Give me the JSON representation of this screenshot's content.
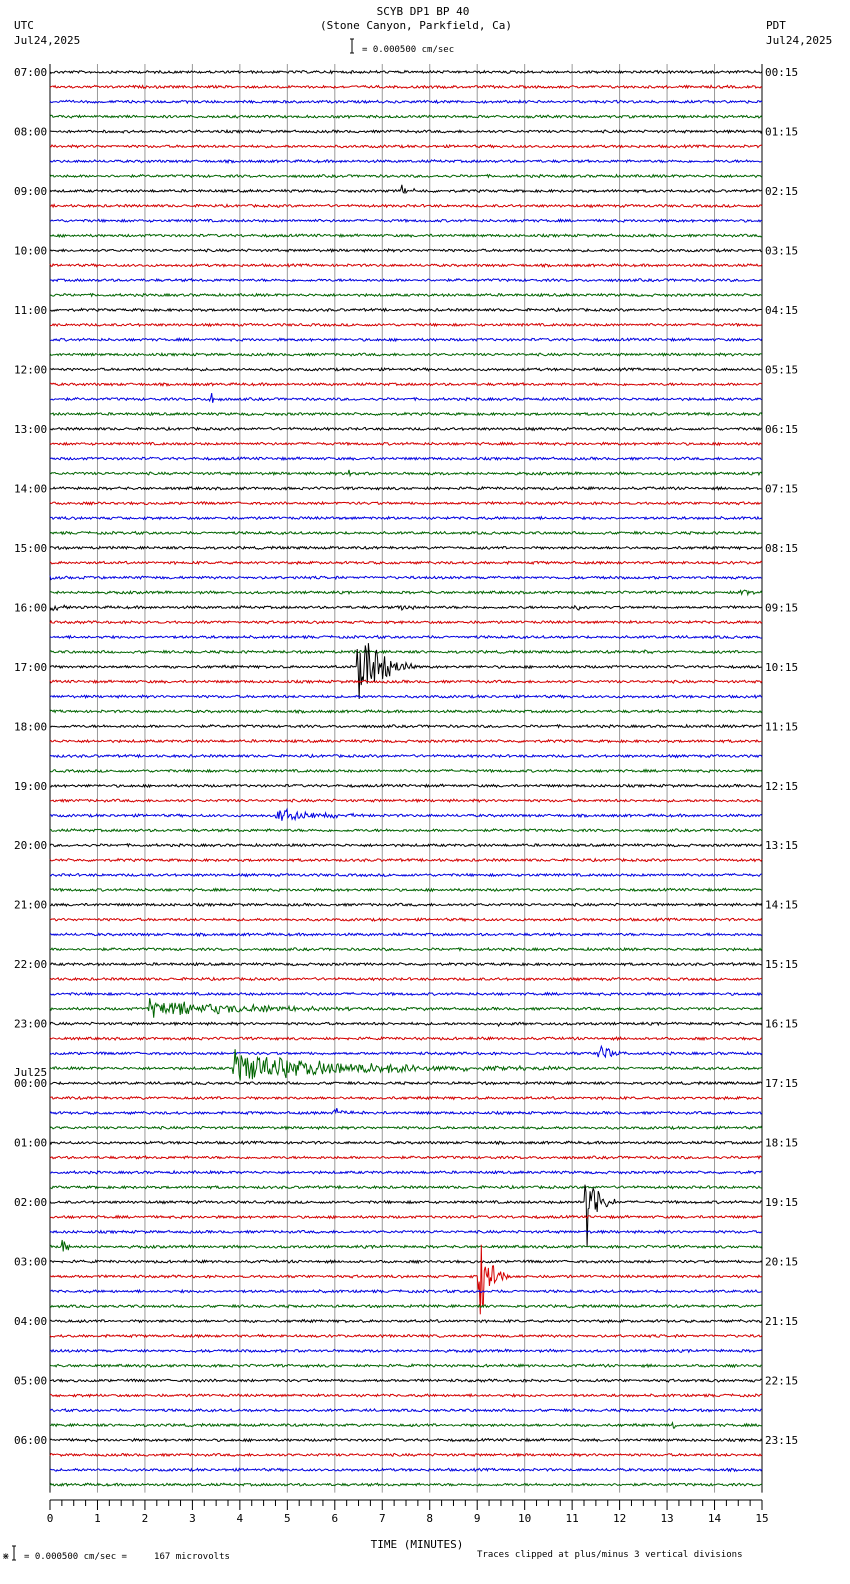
{
  "header": {
    "title": "SCYB DP1 BP 40",
    "subtitle": "(Stone Canyon, Parkfield, Ca)",
    "left_tz": "UTC",
    "left_date": "Jul24,2025",
    "right_tz": "PDT",
    "right_date": "Jul24,2025",
    "scale_label": "= 0.000500 cm/sec"
  },
  "footer": {
    "scale_prefix": "⋇",
    "scale_label": "= 0.000500 cm/sec =     167 microvolts",
    "clip_note": "Traces clipped at plus/minus 3 vertical divisions"
  },
  "colors": [
    "#000000",
    "#d40000",
    "#0000e0",
    "#006400"
  ],
  "chart_data": {
    "type": "line",
    "subtype": "helicorder",
    "xlabel": "TIME (MINUTES)",
    "xlim": [
      0,
      15
    ],
    "xticks": [
      "0",
      "1",
      "2",
      "3",
      "4",
      "5",
      "6",
      "7",
      "8",
      "9",
      "10",
      "11",
      "12",
      "13",
      "14",
      "15"
    ],
    "traces_per_hour": 4,
    "trace_count": 96,
    "grid": true,
    "left_labels": [
      "07:00",
      "08:00",
      "09:00",
      "10:00",
      "11:00",
      "12:00",
      "13:00",
      "14:00",
      "15:00",
      "16:00",
      "17:00",
      "18:00",
      "19:00",
      "20:00",
      "21:00",
      "22:00",
      "23:00",
      "00:00",
      "01:00",
      "02:00",
      "03:00",
      "04:00",
      "05:00",
      "06:00"
    ],
    "date_change_label": "Jul25",
    "right_labels": [
      "00:15",
      "01:15",
      "02:15",
      "03:15",
      "04:15",
      "05:15",
      "06:15",
      "07:15",
      "08:15",
      "09:15",
      "10:15",
      "11:15",
      "12:15",
      "13:15",
      "14:15",
      "15:15",
      "16:15",
      "17:15",
      "18:15",
      "19:15",
      "20:15",
      "21:15",
      "22:15",
      "23:15"
    ],
    "events": [
      {
        "trace": 8,
        "minute": 7.4,
        "amplitude": 0.3,
        "duration": 0.6
      },
      {
        "trace": 22,
        "minute": 3.4,
        "amplitude": 0.3,
        "duration": 0.3
      },
      {
        "trace": 27,
        "minute": 6.3,
        "amplitude": 0.2,
        "duration": 0.3
      },
      {
        "trace": 34,
        "minute": 0.0,
        "amplitude": 0.15,
        "duration": 1.2
      },
      {
        "trace": 35,
        "minute": 14.6,
        "amplitude": 0.35,
        "duration": 0.4
      },
      {
        "trace": 36,
        "minute": 0.0,
        "amplitude": 0.25,
        "duration": 0.8
      },
      {
        "trace": 36,
        "minute": 7.4,
        "amplitude": 0.2,
        "duration": 0.6
      },
      {
        "trace": 36,
        "minute": 11.1,
        "amplitude": 0.2,
        "duration": 0.6
      },
      {
        "trace": 39,
        "minute": 12.5,
        "amplitude": 0.15,
        "duration": 0.4
      },
      {
        "trace": 40,
        "minute": 6.5,
        "amplitude": 3.0,
        "duration": 1.2
      },
      {
        "trace": 50,
        "minute": 4.8,
        "amplitude": 0.5,
        "duration": 2.0
      },
      {
        "trace": 63,
        "minute": 2.1,
        "amplitude": 0.6,
        "duration": 6.0
      },
      {
        "trace": 64,
        "minute": 9.4,
        "amplitude": 0.15,
        "duration": 0.4
      },
      {
        "trace": 66,
        "minute": 11.6,
        "amplitude": 0.6,
        "duration": 0.7
      },
      {
        "trace": 67,
        "minute": 3.9,
        "amplitude": 1.0,
        "duration": 7.0
      },
      {
        "trace": 70,
        "minute": 6.0,
        "amplitude": 0.2,
        "duration": 1.0
      },
      {
        "trace": 76,
        "minute": 11.3,
        "amplitude": 3.0,
        "duration": 0.6
      },
      {
        "trace": 79,
        "minute": 0.25,
        "amplitude": 0.6,
        "duration": 0.4
      },
      {
        "trace": 81,
        "minute": 9.05,
        "amplitude": 3.0,
        "duration": 0.6
      },
      {
        "trace": 91,
        "minute": 13.1,
        "amplitude": 0.25,
        "duration": 0.3
      }
    ]
  }
}
